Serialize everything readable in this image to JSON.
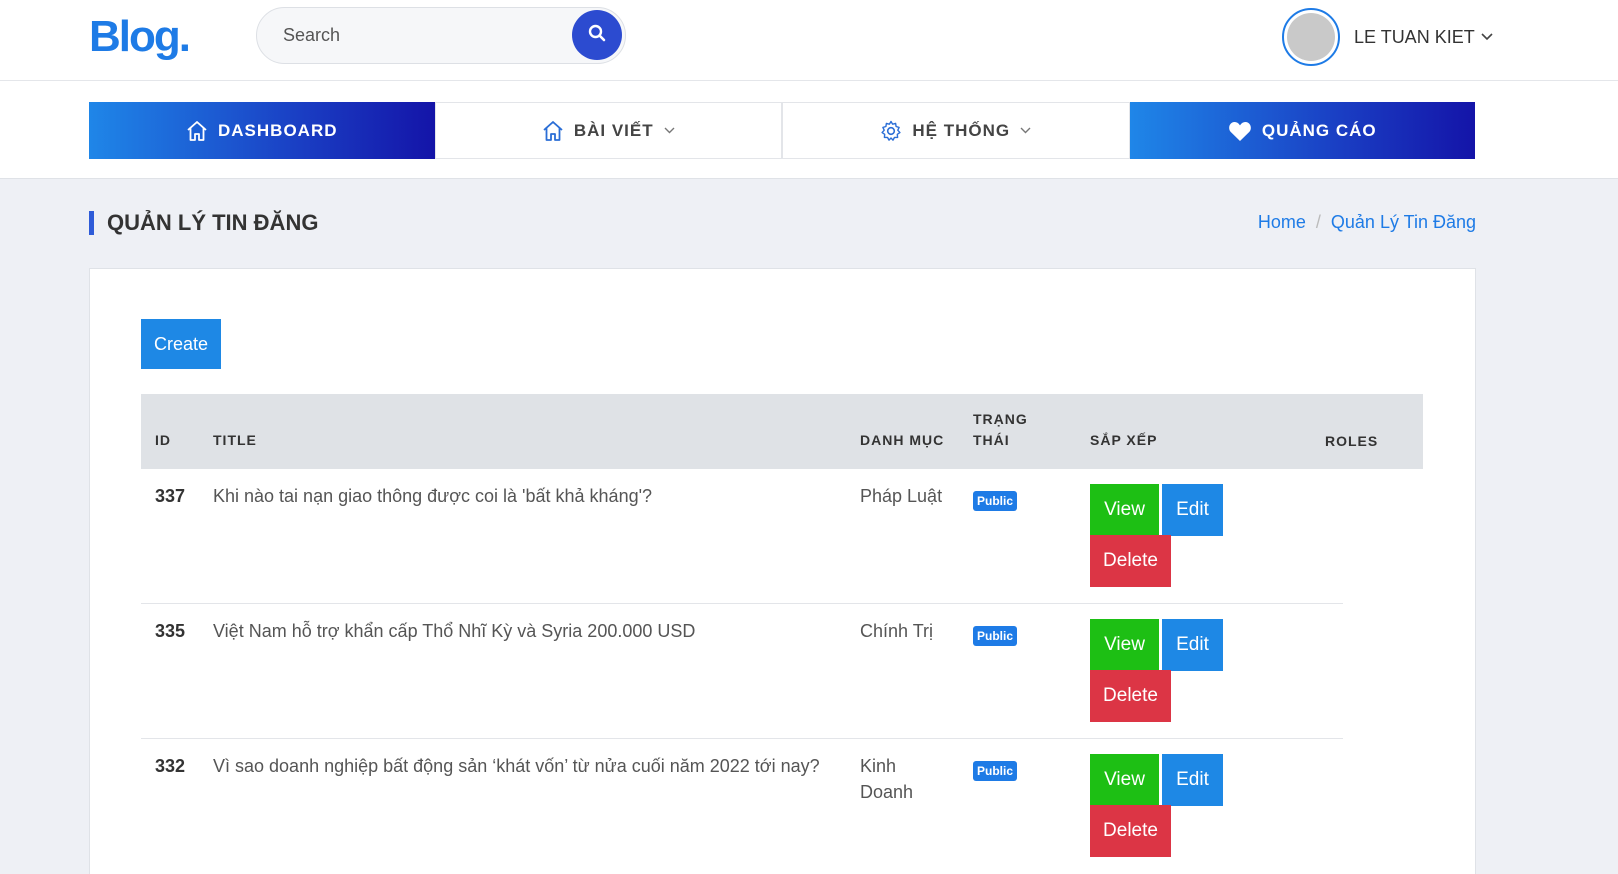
{
  "header": {
    "logo": "Blog.",
    "search_placeholder": "Search",
    "user_name": "LE TUAN KIET"
  },
  "nav": {
    "items": [
      {
        "label": "DASHBOARD"
      },
      {
        "label": "BÀI VIẾT"
      },
      {
        "label": "HỆ THỐNG"
      },
      {
        "label": "QUẢNG CÁO"
      }
    ]
  },
  "page": {
    "title": "QUẢN LÝ TIN ĐĂNG",
    "breadcrumb": [
      "Home",
      "Quản Lý Tin Đăng"
    ],
    "breadcrumb_sep": "/"
  },
  "table": {
    "create_label": "Create",
    "columns": {
      "id": "ID",
      "title": "TITLE",
      "category": "DANH MỤC",
      "status_line1": "TRẠNG",
      "status_line2": "THÁI",
      "sort": "SẮP XẾP",
      "roles": "ROLES"
    },
    "rows": [
      {
        "id": "337",
        "title": "Khi nào tai nạn giao thông được coi là 'bất khả kháng'?",
        "category": "Pháp Luật",
        "status": "Public",
        "view": "View",
        "edit": "Edit",
        "delete": "Delete"
      },
      {
        "id": "335",
        "title": "Việt Nam hỗ trợ khẩn cấp Thổ Nhĩ Kỳ và Syria 200.000 USD",
        "category": "Chính Trị",
        "status": "Public",
        "view": "View",
        "edit": "Edit",
        "delete": "Delete"
      },
      {
        "id": "332",
        "title": "Vì sao doanh nghiệp bất động sản ‘khát vốn’ từ nửa cuối năm 2022 tới nay?",
        "category": "Kinh Doanh",
        "status": "Public",
        "view": "View",
        "edit": "Edit",
        "delete": "Delete"
      }
    ]
  },
  "colors": {
    "brand": "#1e7be6",
    "view": "#1dbf14",
    "edit": "#1e88e5",
    "delete": "#dc3545",
    "header_bg": "#dfe2e6"
  },
  "icons": [
    "search-icon",
    "avatar",
    "chevron-down-icon",
    "home-icon",
    "gear-icon",
    "heart-icon"
  ]
}
